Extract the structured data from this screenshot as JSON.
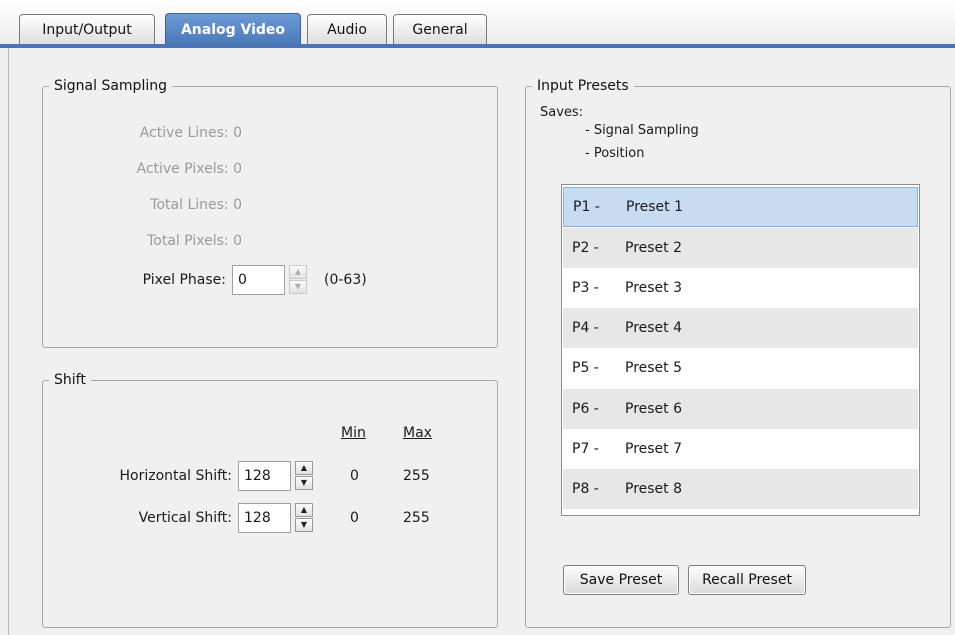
{
  "tabs": [
    {
      "label": "Input/Output"
    },
    {
      "label": "Analog Video"
    },
    {
      "label": "Audio"
    },
    {
      "label": "General"
    }
  ],
  "active_tab": "Analog Video",
  "signal_sampling": {
    "title": "Signal Sampling",
    "active_lines": "Active Lines:  0",
    "active_pixels": "Active Pixels:  0",
    "total_lines": "Total Lines:  0",
    "total_pixels": "Total Pixels:  0",
    "pixel_phase_label": "Pixel Phase:",
    "pixel_phase_value": "0",
    "pixel_phase_range": "(0-63)"
  },
  "shift": {
    "title": "Shift",
    "min_header": "Min",
    "max_header": "Max",
    "horizontal_label": "Horizontal Shift:",
    "horizontal_value": "128",
    "horizontal_min": "0",
    "horizontal_max": "255",
    "vertical_label": "Vertical Shift:",
    "vertical_value": "128",
    "vertical_min": "0",
    "vertical_max": "255"
  },
  "input_presets": {
    "title": "Input Presets",
    "saves_label": "Saves:",
    "saves_items": [
      "- Signal Sampling",
      "- Position"
    ],
    "selected_index": 0,
    "presets": [
      {
        "code": "P1 -",
        "name": "Preset 1"
      },
      {
        "code": "P2 -",
        "name": "Preset 2"
      },
      {
        "code": "P3 -",
        "name": "Preset 3"
      },
      {
        "code": "P4 -",
        "name": "Preset 4"
      },
      {
        "code": "P5 -",
        "name": "Preset 5"
      },
      {
        "code": "P6 -",
        "name": "Preset 6"
      },
      {
        "code": "P7 -",
        "name": "Preset 7"
      },
      {
        "code": "P8 -",
        "name": "Preset 8"
      }
    ],
    "save_button": "Save Preset",
    "recall_button": "Recall Preset"
  },
  "colors": {
    "active_tab": "#5a86c5",
    "tab_underline": "#4a74b4",
    "selected_row": "#c7dbf1"
  }
}
